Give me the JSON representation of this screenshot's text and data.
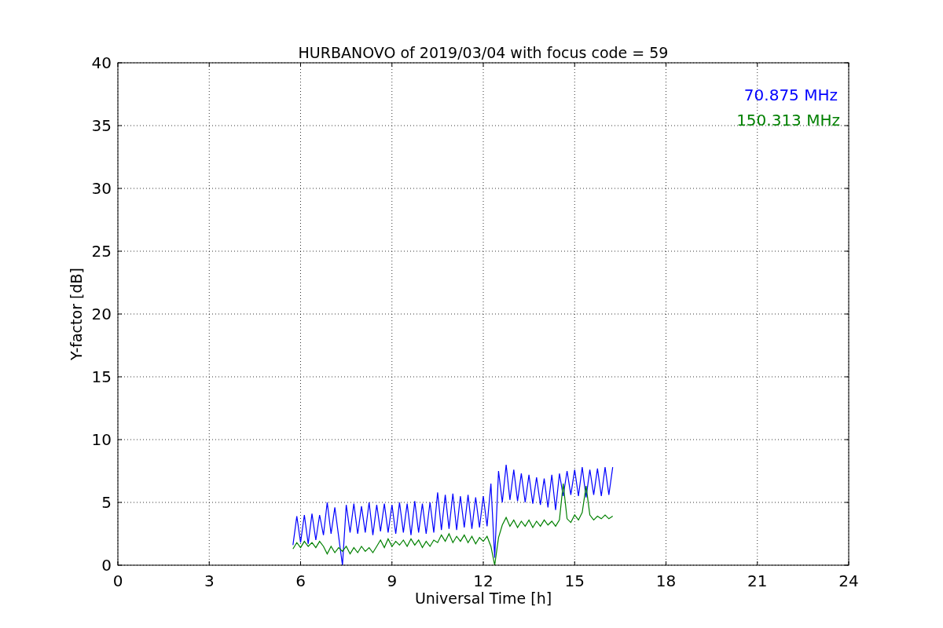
{
  "chart_data": {
    "type": "line",
    "title": "HURBANOVO of 2019/03/04 with focus code = 59",
    "xlabel": "Universal Time [h]",
    "ylabel": "Y-factor [dB]",
    "xlim": [
      0,
      24
    ],
    "ylim": [
      0,
      40
    ],
    "xticks": [
      0,
      3,
      6,
      9,
      12,
      15,
      18,
      21,
      24
    ],
    "yticks": [
      0,
      5,
      10,
      15,
      20,
      25,
      30,
      35,
      40
    ],
    "grid": true,
    "x": [
      5.75,
      5.875,
      6,
      6.125,
      6.25,
      6.375,
      6.5,
      6.625,
      6.75,
      6.875,
      7,
      7.125,
      7.25,
      7.375,
      7.5,
      7.625,
      7.75,
      7.875,
      8,
      8.125,
      8.25,
      8.375,
      8.5,
      8.625,
      8.75,
      8.875,
      9,
      9.125,
      9.25,
      9.375,
      9.5,
      9.625,
      9.75,
      9.875,
      10,
      10.125,
      10.25,
      10.375,
      10.5,
      10.625,
      10.75,
      10.875,
      11,
      11.125,
      11.25,
      11.375,
      11.5,
      11.625,
      11.75,
      11.875,
      12,
      12.125,
      12.25,
      12.375,
      12.5,
      12.625,
      12.75,
      12.875,
      13,
      13.125,
      13.25,
      13.375,
      13.5,
      13.625,
      13.75,
      13.875,
      14,
      14.125,
      14.25,
      14.375,
      14.5,
      14.625,
      14.75,
      14.875,
      15,
      15.125,
      15.25,
      15.375,
      15.5,
      15.625,
      15.75,
      15.875,
      16,
      16.125,
      16.25
    ],
    "series": [
      {
        "name": "70.875 MHz",
        "color": "#0000ff",
        "values": [
          1.6,
          3.9,
          1.8,
          4.0,
          1.7,
          4.1,
          2.0,
          4.0,
          2.4,
          5.0,
          2.5,
          4.6,
          2.3,
          0.0,
          4.8,
          2.6,
          4.9,
          2.5,
          4.7,
          2.6,
          5.0,
          2.4,
          4.8,
          2.7,
          4.9,
          2.6,
          4.8,
          2.5,
          5.0,
          2.6,
          4.9,
          2.4,
          5.1,
          2.6,
          4.9,
          2.5,
          5.0,
          2.6,
          5.8,
          2.8,
          5.6,
          2.9,
          5.7,
          2.8,
          5.5,
          3.0,
          5.6,
          2.9,
          5.4,
          3.0,
          5.5,
          3.1,
          6.5,
          0.6,
          7.5,
          5.0,
          8.0,
          5.2,
          7.6,
          5.1,
          7.3,
          5.0,
          7.2,
          4.9,
          7.0,
          4.8,
          6.9,
          4.6,
          7.2,
          4.4,
          7.3,
          5.5,
          7.5,
          5.6,
          7.6,
          5.5,
          7.8,
          5.4,
          7.6,
          5.6,
          7.7,
          5.5,
          7.8,
          5.6,
          7.8
        ]
      },
      {
        "name": "150.313 MHz",
        "color": "#008000",
        "values": [
          1.3,
          1.8,
          1.4,
          1.9,
          1.5,
          1.8,
          1.4,
          1.9,
          1.5,
          0.9,
          1.5,
          1.0,
          1.4,
          1.1,
          1.5,
          0.9,
          1.4,
          1.0,
          1.5,
          1.1,
          1.4,
          1.0,
          1.5,
          2.0,
          1.4,
          2.1,
          1.5,
          1.9,
          1.6,
          2.0,
          1.5,
          2.1,
          1.6,
          2.0,
          1.4,
          1.9,
          1.5,
          2.0,
          1.8,
          2.4,
          1.9,
          2.5,
          1.8,
          2.3,
          1.9,
          2.4,
          1.8,
          2.3,
          1.7,
          2.2,
          1.9,
          2.3,
          1.5,
          0.0,
          2.2,
          3.2,
          3.8,
          3.1,
          3.6,
          3.0,
          3.5,
          3.1,
          3.6,
          3.0,
          3.5,
          3.1,
          3.6,
          3.2,
          3.5,
          3.1,
          3.6,
          6.5,
          3.7,
          3.4,
          4.0,
          3.6,
          4.2,
          6.3,
          4.0,
          3.6,
          3.9,
          3.7,
          4.0,
          3.7,
          3.9
        ]
      }
    ]
  }
}
